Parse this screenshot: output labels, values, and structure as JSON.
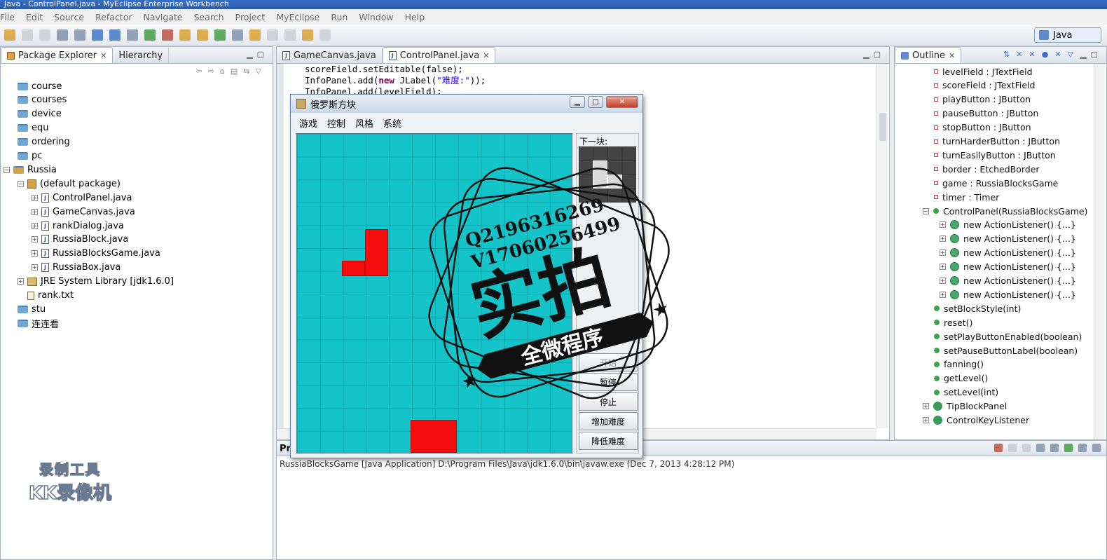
{
  "window": {
    "title": "Java - ControlPanel.java - MyEclipse Enterprise Workbench"
  },
  "menu": [
    "File",
    "Edit",
    "Source",
    "Refactor",
    "Navigate",
    "Search",
    "Project",
    "MyEclipse",
    "Run",
    "Window",
    "Help"
  ],
  "perspective": {
    "label": "Java"
  },
  "explorer": {
    "tabs": [
      "Package Explorer",
      "Hierarchy"
    ],
    "items": [
      {
        "label": "course",
        "icon": "folder-icon"
      },
      {
        "label": "courses",
        "icon": "folder-icon"
      },
      {
        "label": "device",
        "icon": "folder-icon"
      },
      {
        "label": "equ",
        "icon": "folder-icon"
      },
      {
        "label": "ordering",
        "icon": "folder-icon"
      },
      {
        "label": "pc",
        "icon": "folder-icon"
      },
      {
        "label": "Russia",
        "icon": "project-icon"
      },
      {
        "label": "(default package)",
        "icon": "package-icon"
      },
      {
        "label": "ControlPanel.java",
        "icon": "java-file-icon"
      },
      {
        "label": "GameCanvas.java",
        "icon": "java-file-icon"
      },
      {
        "label": "rankDialog.java",
        "icon": "java-file-icon"
      },
      {
        "label": "RussiaBlock.java",
        "icon": "java-file-icon"
      },
      {
        "label": "RussiaBlocksGame.java",
        "icon": "java-file-icon"
      },
      {
        "label": "RussiaBox.java",
        "icon": "java-file-icon"
      },
      {
        "label": "JRE System Library [jdk1.6.0]",
        "icon": "library-icon"
      },
      {
        "label": "rank.txt",
        "icon": "text-file-icon"
      },
      {
        "label": "stu",
        "icon": "folder-icon"
      },
      {
        "label": "连连看",
        "icon": "folder-icon"
      }
    ]
  },
  "editor": {
    "tabs": [
      "GameCanvas.java",
      "ControlPanel.java"
    ],
    "lines": {
      "l1": "scoreField.setEditable(false);",
      "l2a": "InfoPanel.add(",
      "l2kw": "new",
      "l2b": " JLabel(",
      "l2str": "\"难度:\"",
      "l2c": "));",
      "l3": "InfoPanel.add(levelField);"
    }
  },
  "outline": {
    "tab": "Outline",
    "items": [
      {
        "label": "levelField : JTextField",
        "kind": "field"
      },
      {
        "label": "scoreField : JTextField",
        "kind": "field"
      },
      {
        "label": "playButton : JButton",
        "kind": "field"
      },
      {
        "label": "pauseButton : JButton",
        "kind": "field"
      },
      {
        "label": "stopButton : JButton",
        "kind": "field"
      },
      {
        "label": "turnHarderButton : JButton",
        "kind": "field"
      },
      {
        "label": "turnEasilyButton : JButton",
        "kind": "field"
      },
      {
        "label": "border : EtchedBorder",
        "kind": "field"
      },
      {
        "label": "game : RussiaBlocksGame",
        "kind": "field"
      },
      {
        "label": "timer : Timer",
        "kind": "field"
      },
      {
        "label": "ControlPanel(RussiaBlocksGame)",
        "kind": "constructor"
      },
      {
        "label": "new ActionListener() {...}",
        "kind": "anon"
      },
      {
        "label": "new ActionListener() {...}",
        "kind": "anon"
      },
      {
        "label": "new ActionListener() {...}",
        "kind": "anon"
      },
      {
        "label": "new ActionListener() {...}",
        "kind": "anon"
      },
      {
        "label": "new ActionListener() {...}",
        "kind": "anon"
      },
      {
        "label": "new ActionListener() {...}",
        "kind": "anon"
      },
      {
        "label": "setBlockStyle(int)",
        "kind": "method"
      },
      {
        "label": "reset()",
        "kind": "method"
      },
      {
        "label": "setPlayButtonEnabled(boolean)",
        "kind": "method"
      },
      {
        "label": "setPauseButtonLabel(boolean)",
        "kind": "method"
      },
      {
        "label": "fanning()",
        "kind": "method"
      },
      {
        "label": "getLevel()",
        "kind": "method"
      },
      {
        "label": "setLevel(int)",
        "kind": "method"
      },
      {
        "label": "TipBlockPanel",
        "kind": "class"
      },
      {
        "label": "ControlKeyListener",
        "kind": "class"
      }
    ]
  },
  "console": {
    "tab_partial": "Pro",
    "line": "RussiaBlocksGame [Java Application] D:\\Program Files\\Java\\jdk1.6.0\\bin\\javaw.exe (Dec 7, 2013 4:28:12 PM)"
  },
  "game": {
    "title": "俄罗斯方块",
    "menu": [
      "游戏",
      "控制",
      "风格",
      "系统"
    ],
    "next_label": "下一块:",
    "buttons": {
      "start": "开始",
      "pause": "暂停",
      "stop": "停止",
      "harder": "增加难度",
      "easier": "降低难度"
    },
    "colors": {
      "board": "#14c4c8",
      "block": "#f50d0d"
    }
  },
  "stamp": {
    "line1": "Q2196316269",
    "line2": "V17060256499",
    "big": "实拍",
    "banner": "全微程序"
  },
  "watermark": {
    "line1": "录制工具",
    "line2": "KK录像机"
  }
}
